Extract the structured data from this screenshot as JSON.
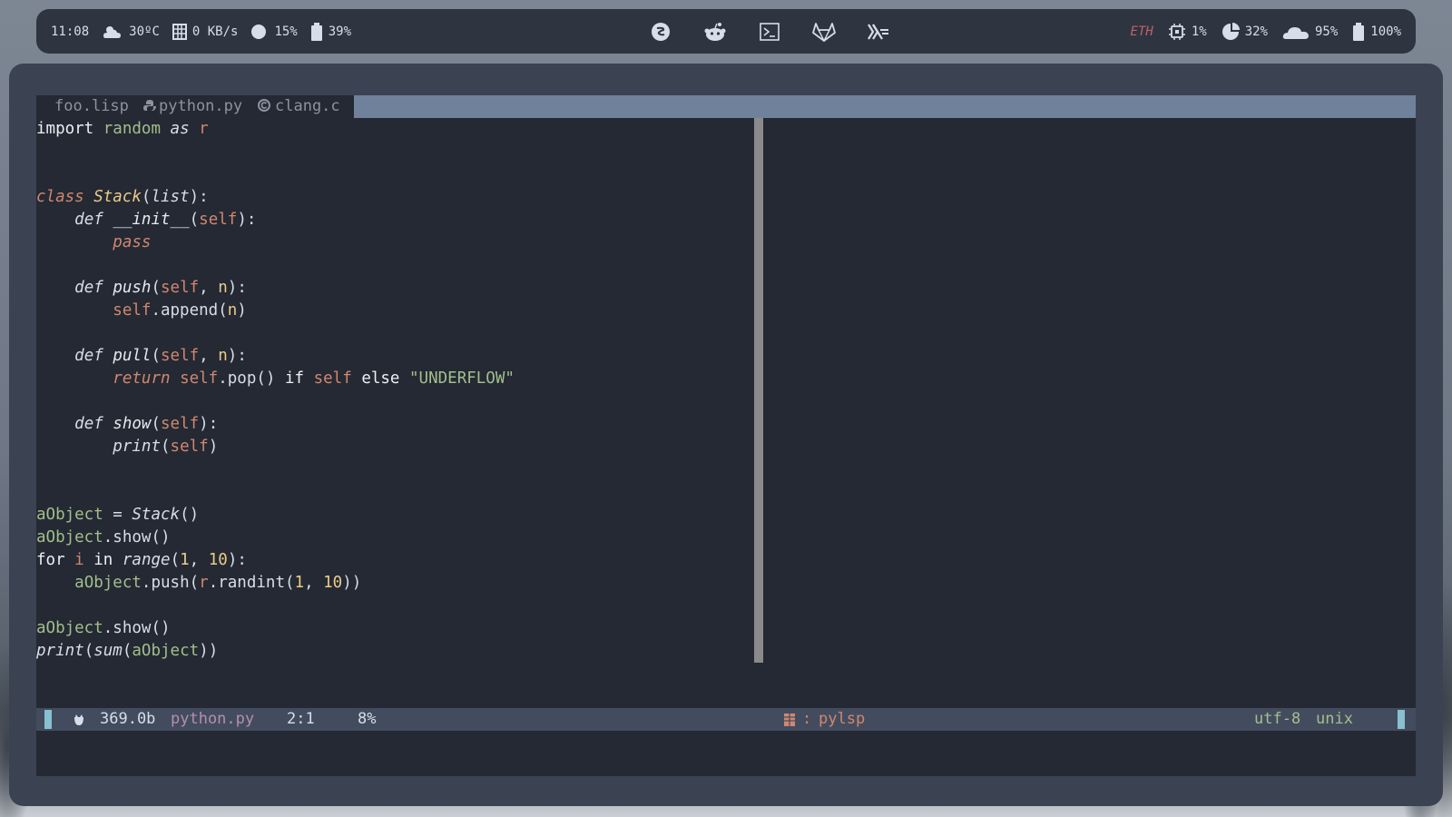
{
  "topbar": {
    "clock": "11:08",
    "temperature": "30ºC",
    "network": "0 KB/s",
    "cpu": "15%",
    "memory": "39%",
    "eth_label": "ETH",
    "cpu_load": "1%",
    "disk": "32%",
    "cloud": "95%",
    "battery": "100%",
    "center_apps": [
      "emacs-icon",
      "reddit-icon",
      "terminal-icon",
      "gitlab-icon",
      "haskell-icon"
    ]
  },
  "tabs": [
    {
      "label": "foo.lisp",
      "icon": ""
    },
    {
      "label": "python.py",
      "icon": "python-icon"
    },
    {
      "label": "clang.c",
      "icon": "c-icon"
    }
  ],
  "code": {
    "l1": [
      "import",
      "random",
      "as",
      "r"
    ],
    "l4": [
      "class",
      "Stack",
      "(",
      "list",
      "):"
    ],
    "l5": [
      "def",
      "__init__",
      "(",
      "self",
      "):"
    ],
    "l6": [
      "pass"
    ],
    "l8": [
      "def",
      "push",
      "(",
      "self",
      ", ",
      "n",
      "):"
    ],
    "l9": [
      "self",
      ".append(",
      "n",
      ")"
    ],
    "l11": [
      "def",
      "pull",
      "(",
      "self",
      ", ",
      "n",
      "):"
    ],
    "l12": [
      "return",
      "self",
      ".pop() ",
      "if",
      "self",
      "else",
      "\"UNDERFLOW\""
    ],
    "l14": [
      "def",
      "show",
      "(",
      "self",
      "):"
    ],
    "l15": [
      "print",
      "(",
      "self",
      ")"
    ],
    "l18": [
      "aObject",
      " = ",
      "Stack",
      "()"
    ],
    "l19": [
      "aObject",
      ".show()"
    ],
    "l20": [
      "for",
      "i",
      "in",
      "range",
      "(",
      "1",
      ", ",
      "10",
      "):"
    ],
    "l21": [
      "aObject",
      ".push(",
      "r",
      ".randint(",
      "1",
      ", ",
      "10",
      "))"
    ],
    "l23": [
      "aObject",
      ".show()"
    ],
    "l24": [
      "print",
      "(",
      "sum",
      "(",
      "aObject",
      "))"
    ]
  },
  "statusline": {
    "filesize": "369.0b",
    "filename": "python.py",
    "position": "2:1",
    "percent": "8%",
    "lsp_sep": ":",
    "lsp": "pylsp",
    "encoding": "utf-8",
    "format": "unix"
  },
  "colors": {
    "bar_bg": "#2e3440",
    "editor_bg": "#242933",
    "tabline_fill": "#6f819b",
    "accent": "#88c0d0",
    "keyword_orange": "#d08770",
    "green": "#a3be8c",
    "yellow": "#ebcb8b"
  }
}
